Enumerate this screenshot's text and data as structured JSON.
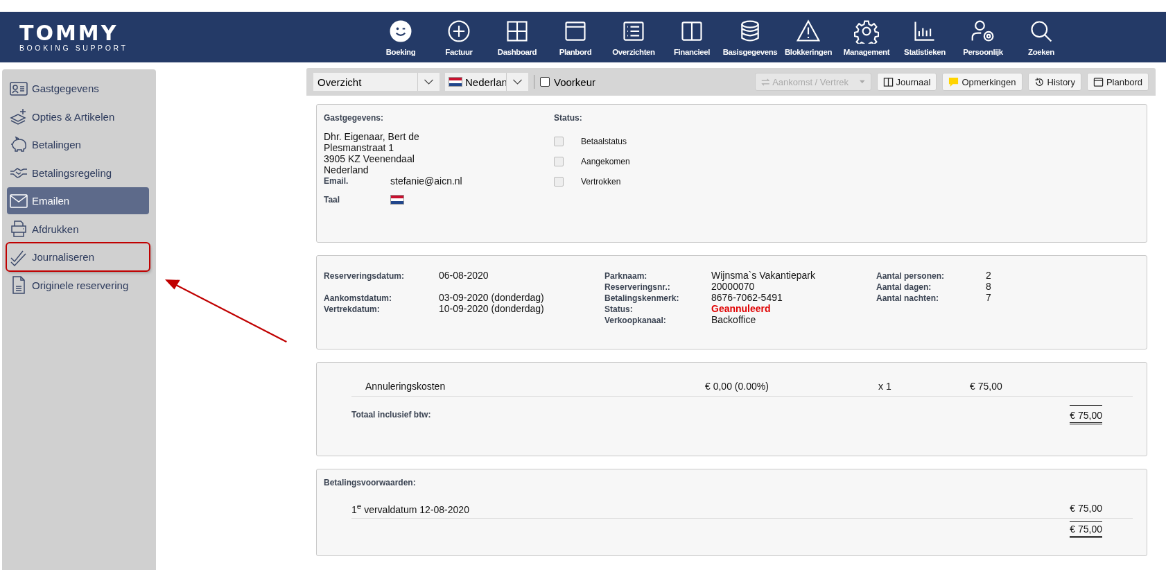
{
  "logo": {
    "name": "TOMMY",
    "tagline": "BOOKING SUPPORT"
  },
  "nav": [
    {
      "label": "Boeking"
    },
    {
      "label": "Factuur"
    },
    {
      "label": "Dashboard"
    },
    {
      "label": "Planbord"
    },
    {
      "label": "Overzichten"
    },
    {
      "label": "Financieel"
    },
    {
      "label": "Basisgegevens"
    },
    {
      "label": "Blokkeringen"
    },
    {
      "label": "Management"
    },
    {
      "label": "Statistieken"
    },
    {
      "label": "Persoonlijk"
    },
    {
      "label": "Zoeken"
    }
  ],
  "sidebar": {
    "items": [
      {
        "label": "Gastgegevens",
        "selected": false,
        "highlighted": false
      },
      {
        "label": "Opties & Artikelen",
        "selected": false,
        "highlighted": false
      },
      {
        "label": "Betalingen",
        "selected": false,
        "highlighted": false
      },
      {
        "label": "Betalingsregeling",
        "selected": false,
        "highlighted": false
      },
      {
        "label": "Emailen",
        "selected": true,
        "highlighted": false
      },
      {
        "label": "Afdrukken",
        "selected": false,
        "highlighted": false
      },
      {
        "label": "Journaliseren",
        "selected": false,
        "highlighted": true
      },
      {
        "label": "Originele reservering",
        "selected": false,
        "highlighted": false
      }
    ]
  },
  "toolbar": {
    "view_select": "Overzicht",
    "language_select": "Nederlan",
    "preference": {
      "label": "Voorkeur",
      "checked": false
    },
    "buttons": [
      {
        "label": "Aankomst / Vertrek",
        "disabled": true,
        "dropdown": true
      },
      {
        "label": "Journaal",
        "disabled": false,
        "dropdown": false
      },
      {
        "label": "Opmerkingen",
        "disabled": false,
        "dropdown": false
      },
      {
        "label": "History",
        "disabled": false,
        "dropdown": false
      },
      {
        "label": "Planbord",
        "disabled": false,
        "dropdown": false
      }
    ]
  },
  "guest": {
    "heading": "Gastgegevens:",
    "lines": [
      "Dhr. Eigenaar, Bert de",
      "Plesmanstraat 1",
      "3905 KZ Veenendaal",
      "Nederland"
    ],
    "email_label": "Email.",
    "email": "stefanie@aicn.nl",
    "language_label": "Taal"
  },
  "status": {
    "heading": "Status:",
    "checks": [
      {
        "label": "Betaalstatus",
        "checked": false
      },
      {
        "label": "Aangekomen",
        "checked": false
      },
      {
        "label": "Vertrokken",
        "checked": false
      }
    ]
  },
  "reservation": {
    "columns": [
      [
        {
          "label": "Reserveringsdatum:",
          "value": "06-08-2020",
          "kind": "plain"
        },
        {
          "label": "Aankomstdatum:",
          "value": "03-09-2020 (donderdag)",
          "kind": "plain"
        },
        {
          "label": "Vertrekdatum:",
          "value": "10-09-2020 (donderdag)",
          "kind": "plain"
        }
      ],
      [
        {
          "label": "Parknaam:",
          "value": "Wijnsma`s Vakantiepark",
          "kind": "plain"
        },
        {
          "label": "Reserveringsnr.:",
          "value": "20000070",
          "kind": "plain"
        },
        {
          "label": "Betalingskenmerk:",
          "value": "8676-7062-5491",
          "kind": "plain"
        },
        {
          "label": "Status:",
          "value": "Geannuleerd",
          "kind": "alert"
        },
        {
          "label": "Verkoopkanaal:",
          "value": "Backoffice",
          "kind": "plain"
        }
      ],
      [
        {
          "label": "Aantal personen:",
          "value": "2",
          "kind": "plain"
        },
        {
          "label": "Aantal dagen:",
          "value": "8",
          "kind": "plain"
        },
        {
          "label": "Aantal nachten:",
          "value": "7",
          "kind": "plain"
        }
      ]
    ]
  },
  "costs": {
    "lines": [
      {
        "description": "Annuleringskosten",
        "price": "€ 0,00 (0.00%)",
        "quantity": "x 1",
        "amount": "€ 75,00"
      }
    ],
    "total_label": "Totaal inclusief btw:",
    "total": "€ 75,00"
  },
  "terms": {
    "heading": "Betalingsvoorwaarden:",
    "lines": [
      {
        "description": "1$^{e}$ vervaldatum 12-08-2020",
        "amount": "€ 75,00"
      }
    ],
    "total": "€ 75,00"
  }
}
